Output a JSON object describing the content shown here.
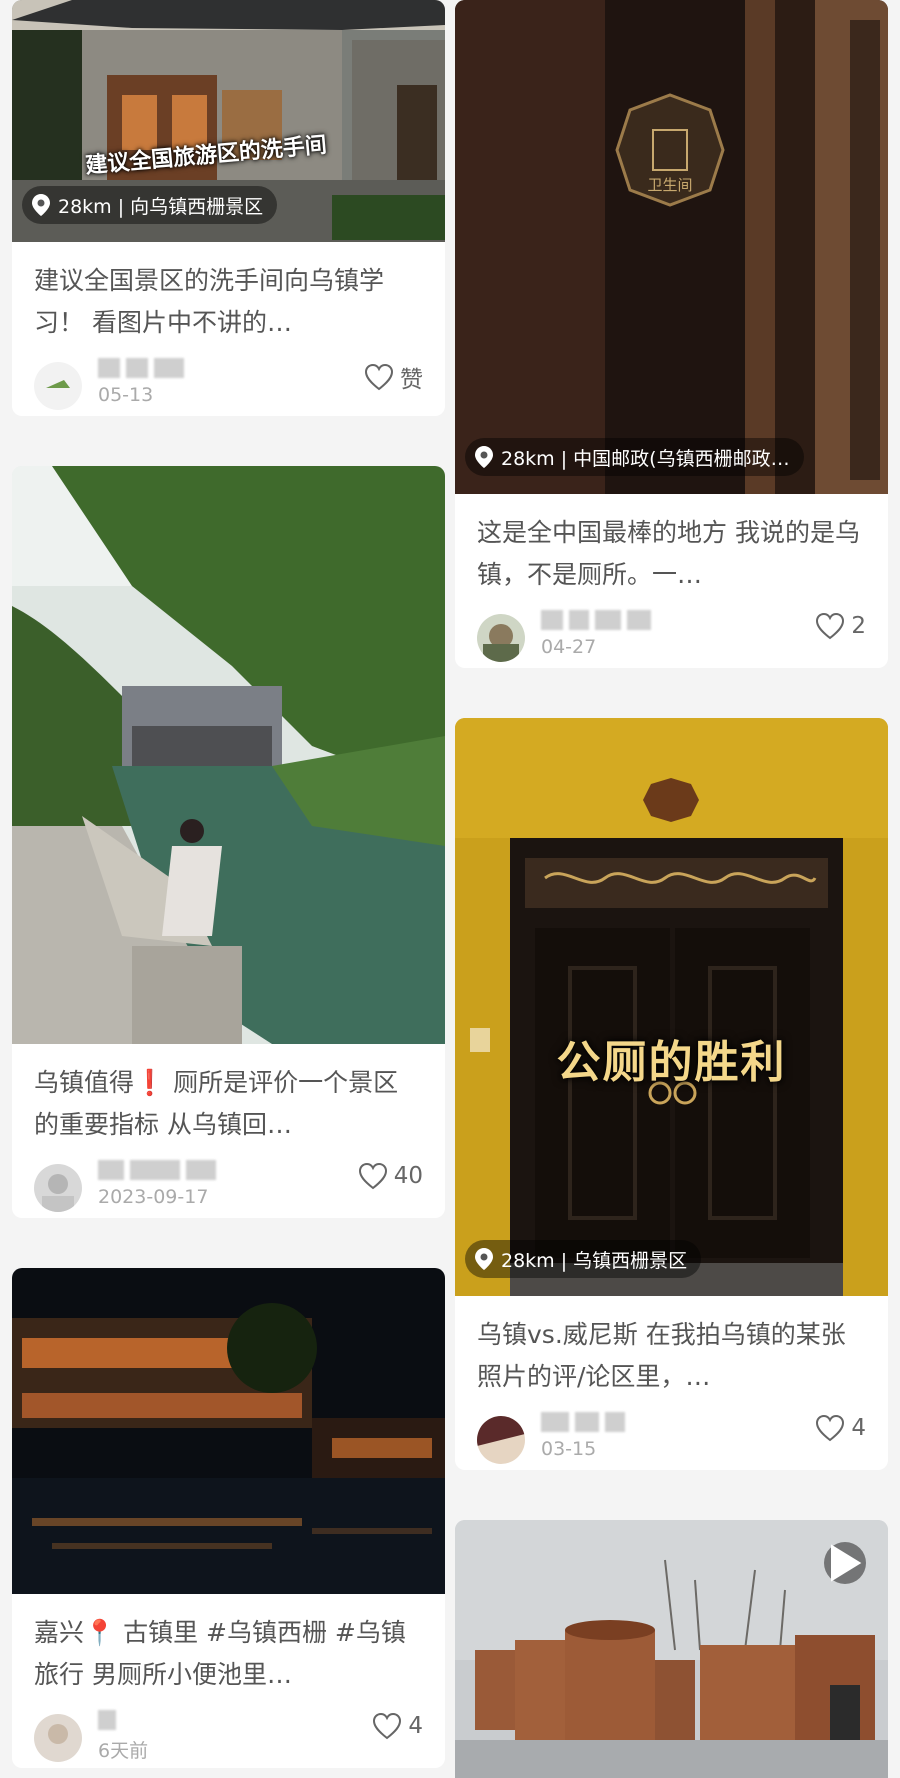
{
  "feed": {
    "left": [
      {
        "overlay_title": "建议全国旅游区的洗手间",
        "location": "28km | 向乌镇西栅景区",
        "title": "建议全国景区的洗手间向乌镇学习！ 看图片中不讲的…",
        "date": "05-13",
        "likes": "赞"
      },
      {
        "title": "乌镇值得❗ 厕所是评价一个景区的重要指标 从乌镇回…",
        "date": "2023-09-17",
        "likes": "40"
      },
      {
        "title": "嘉兴📍 古镇里 #乌镇西栅 #乌镇旅行 男厕所小便池里…",
        "date": "6天前",
        "likes": "4"
      }
    ],
    "right": [
      {
        "sign_text": "卫生间",
        "location": "28km | 中国邮政(乌镇西栅邮政…",
        "title": "这是全中国最棒的地方 我说的是乌镇，不是厕所。一…",
        "date": "04-27",
        "likes": "2"
      },
      {
        "big_caption": "公厕的胜利",
        "location": "28km | 乌镇西栅景区",
        "title": "乌镇vs.威尼斯 在我拍乌镇的某张照片的评/论区里，…",
        "date": "03-15",
        "likes": "4"
      },
      {
        "has_video": true
      }
    ]
  },
  "icons": {
    "location": "location-pin-icon",
    "like": "heart-outline-icon",
    "play": "play-icon"
  },
  "colors": {
    "background": "#f4f4f4",
    "card": "#ffffff",
    "text": "#555555",
    "meta": "#aaaaaa"
  }
}
